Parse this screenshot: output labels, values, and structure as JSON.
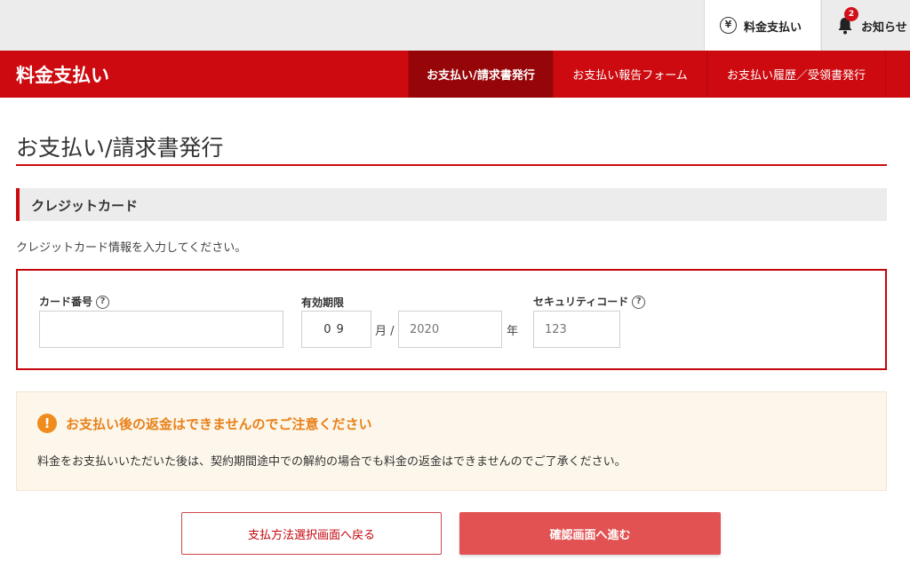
{
  "topbar": {
    "pay_label": "料金支払い",
    "pay_icon": "yen-icon",
    "yen_symbol": "¥",
    "news_label": "お知らせ",
    "news_icon": "bell-icon",
    "news_badge": "2"
  },
  "nav": {
    "title": "料金支払い",
    "tabs": [
      {
        "label": "お支払い/請求書発行",
        "active": true
      },
      {
        "label": "お支払い報告フォーム",
        "active": false
      },
      {
        "label": "お支払い履歴／受領書発行",
        "active": false
      }
    ]
  },
  "page": {
    "title": "お支払い/請求書発行",
    "section_title": "クレジットカード",
    "instruction": "クレジットカード情報を入力してください。"
  },
  "form": {
    "card_number": {
      "label": "カード番号",
      "value": "",
      "help": "?"
    },
    "expiry": {
      "label": "有効期限",
      "month_value": "09",
      "month_unit": "月 /",
      "year_placeholder": "2020",
      "year_unit": "年"
    },
    "security_code": {
      "label": "セキュリティコード",
      "placeholder": "123",
      "help": "?"
    }
  },
  "notice": {
    "icon": "exclamation-icon",
    "icon_glyph": "!",
    "title": "お支払い後の返金はできませんのでご注意ください",
    "body": "料金をお支払いいただいた後は、契約期間途中での解約の場合でも料金の返金はできませんのでご了承ください。"
  },
  "buttons": {
    "back": "支払方法選択画面へ戻る",
    "next": "確認画面へ進む"
  },
  "colors": {
    "brand_red": "#cd0a0f",
    "active_tab": "#960609",
    "notice_orange": "#e8801a",
    "next_button": "#e25252"
  }
}
